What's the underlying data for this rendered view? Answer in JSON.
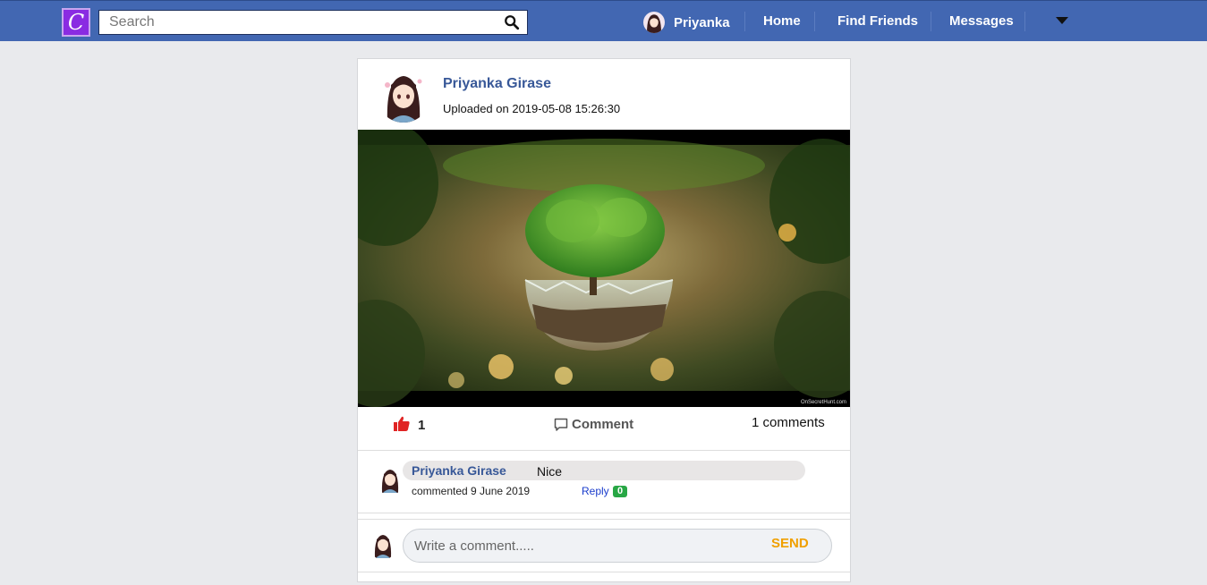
{
  "nav": {
    "logo_letter": "C",
    "search_placeholder": "Search",
    "user_name": "Priyanka",
    "items": [
      "Home",
      "Find Friends",
      "Messages"
    ],
    "brand_color": "#4267b2"
  },
  "post": {
    "author": "Priyanka Girase",
    "uploaded": "Uploaded on 2019-05-08 15:26:30",
    "image_watermark": "OnSecretHunt.com",
    "like_count": "1",
    "comment_label": "Comment",
    "comment_count": "1 comments"
  },
  "comments": [
    {
      "author": "Priyanka Girase",
      "text": "Nice",
      "date": "commented 9 June 2019",
      "reply_label": "Reply",
      "reply_count": "0"
    }
  ],
  "composer": {
    "placeholder": "Write a comment.....",
    "send_label": "SEND"
  }
}
